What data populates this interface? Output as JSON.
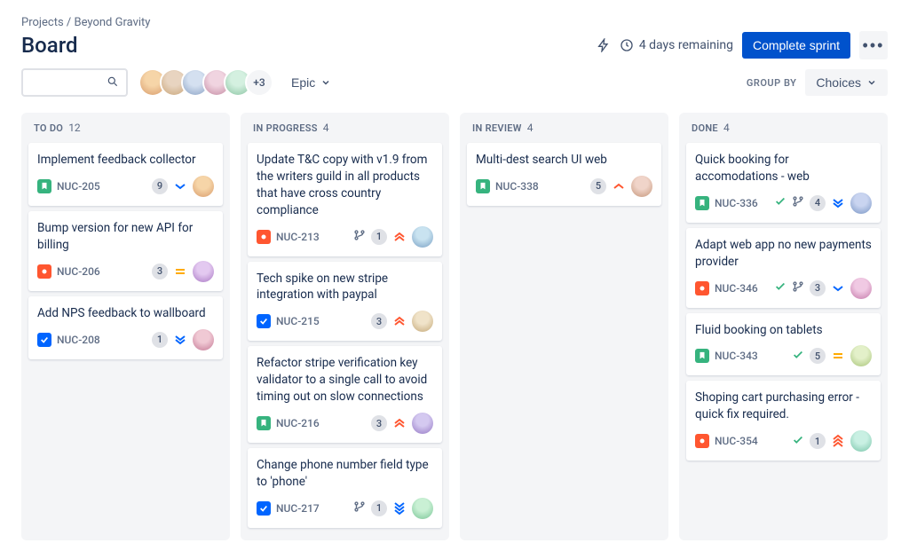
{
  "breadcrumb": "Projects / Beyond Gravity",
  "title": "Board",
  "header": {
    "days_remaining": "4 days remaining",
    "complete_sprint": "Complete sprint",
    "avatar_overflow": "+3",
    "epic_label": "Epic",
    "group_by_label": "GROUP BY",
    "choices_label": "Choices"
  },
  "columns": [
    {
      "title": "TO DO",
      "count": 12,
      "cards": [
        {
          "title": "Implement feedback collector",
          "key": "NUC-205",
          "type": "story",
          "badge": "9",
          "priority": "low-single",
          "check": false,
          "branch": false,
          "avatar": 1
        },
        {
          "title": "Bump version for new API for billing",
          "key": "NUC-206",
          "type": "bug",
          "badge": "3",
          "priority": "medium",
          "check": false,
          "branch": false,
          "avatar": 2
        },
        {
          "title": "Add NPS feedback to wallboard",
          "key": "NUC-208",
          "type": "task",
          "badge": "1",
          "priority": "low-double",
          "check": false,
          "branch": false,
          "avatar": 3
        }
      ]
    },
    {
      "title": "IN PROGRESS",
      "count": 4,
      "cards": [
        {
          "title": "Update T&C copy with v1.9 from the writers guild in all products that have cross country compliance",
          "key": "NUC-213",
          "type": "bug",
          "badge": "1",
          "priority": "high-double",
          "check": false,
          "branch": true,
          "avatar": 4
        },
        {
          "title": "Tech spike on new stripe integration with paypal",
          "key": "NUC-215",
          "type": "task",
          "badge": "3",
          "priority": "high-double",
          "check": false,
          "branch": false,
          "avatar": 5
        },
        {
          "title": "Refactor stripe verification key validator to a single call to avoid timing out on slow connections",
          "key": "NUC-216",
          "type": "story",
          "badge": "3",
          "priority": "high-double",
          "check": false,
          "branch": false,
          "avatar": 6
        },
        {
          "title": "Change phone number field type to 'phone'",
          "key": "NUC-217",
          "type": "task",
          "badge": "1",
          "priority": "lowest-triple",
          "check": false,
          "branch": true,
          "avatar": 7
        }
      ]
    },
    {
      "title": "IN REVIEW",
      "count": 4,
      "cards": [
        {
          "title": "Multi-dest search UI web",
          "key": "NUC-338",
          "type": "story",
          "badge": "5",
          "priority": "high-single",
          "check": false,
          "branch": false,
          "avatar": 8
        }
      ]
    },
    {
      "title": "DONE",
      "count": 4,
      "cards": [
        {
          "title": "Quick booking for accomodations - web",
          "key": "NUC-336",
          "type": "story",
          "badge": "4",
          "priority": "low-double",
          "check": true,
          "branch": true,
          "avatar": 9
        },
        {
          "title": "Adapt web app no new payments provider",
          "key": "NUC-346",
          "type": "bug",
          "badge": "3",
          "priority": "low-single",
          "check": true,
          "branch": true,
          "avatar": 10
        },
        {
          "title": "Fluid booking on tablets",
          "key": "NUC-343",
          "type": "story",
          "badge": "5",
          "priority": "medium",
          "check": true,
          "branch": false,
          "avatar": 11
        },
        {
          "title": "Shoping cart purchasing error - quick fix required.",
          "key": "NUC-354",
          "type": "bug",
          "badge": "1",
          "priority": "highest-triple",
          "check": true,
          "branch": false,
          "avatar": 12
        }
      ]
    }
  ],
  "avatar_colors": {
    "1": [
      "#f6d5a8",
      "#d89b6b"
    ],
    "2": [
      "#e3c9f0",
      "#a978c4"
    ],
    "3": [
      "#f0c9d4",
      "#c47895"
    ],
    "4": [
      "#c9e3f0",
      "#789fc4"
    ],
    "5": [
      "#f0e3c9",
      "#c4a878"
    ],
    "6": [
      "#d4c9f0",
      "#9578c4"
    ],
    "7": [
      "#c9f0d4",
      "#78c495"
    ],
    "8": [
      "#f0d4c9",
      "#c49578"
    ],
    "9": [
      "#c9d4f0",
      "#7895c4"
    ],
    "10": [
      "#f0c9e3",
      "#c478a8"
    ],
    "11": [
      "#e3f0c9",
      "#a8c478"
    ],
    "12": [
      "#c9f0e3",
      "#78c4a8"
    ]
  },
  "stack_colors": [
    [
      "#f6d5a8",
      "#d89b6b"
    ],
    [
      "#e8d4c0",
      "#c9a67a"
    ],
    [
      "#d4e0f0",
      "#8aa2c4"
    ],
    [
      "#f0d4e0",
      "#c48aa2"
    ],
    [
      "#d4f0e0",
      "#8ac4a2"
    ]
  ]
}
